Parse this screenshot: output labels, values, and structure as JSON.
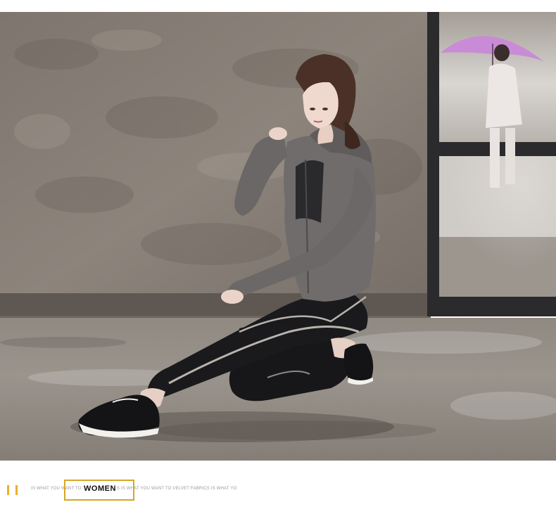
{
  "footer": {
    "tagline": "IS WHAT YOU WANT TO VELVET FABRICS IS WHAT YOU WANT TO VELVET FABRICS IS WHAT YO",
    "title": "WOMEN",
    "accent_color": "#e7b22a",
    "box_color": "#d4a824"
  },
  "photo": {
    "subject": "woman in grey sportswear kneeling on concrete floor",
    "icons": [
      "grey-track-jacket",
      "black-leggings",
      "black-sneaker",
      "purple-umbrella"
    ]
  }
}
